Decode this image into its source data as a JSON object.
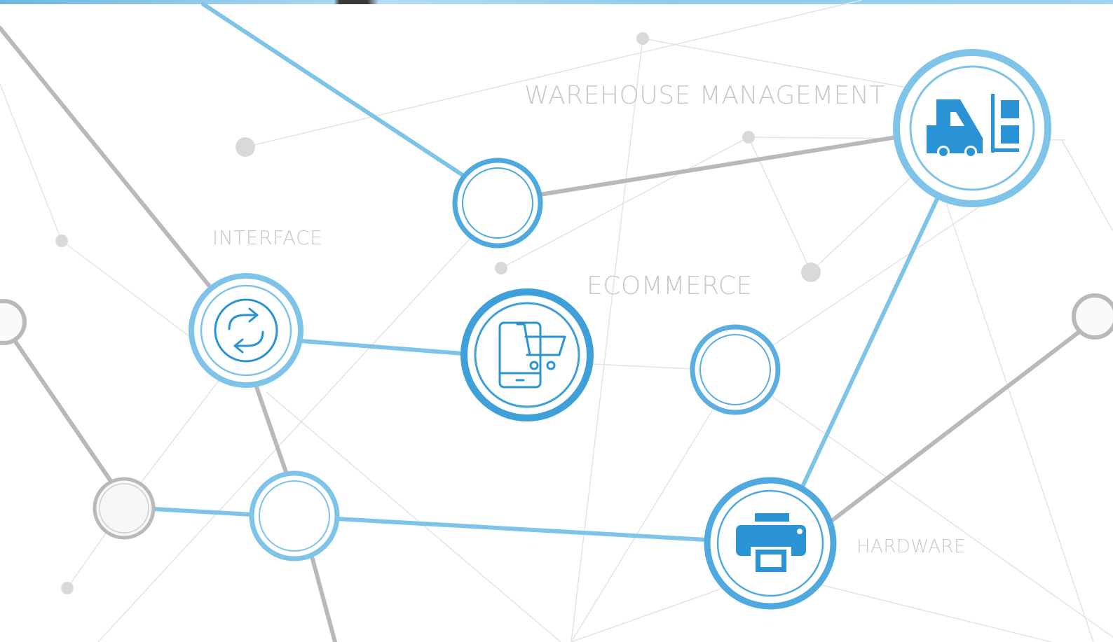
{
  "labels": {
    "warehouse": "WAREHOUSE MANAGEMENT",
    "interface": "INTERFACE",
    "ecommerce": "ECOMMERCE",
    "hardware": "HARDWARE"
  },
  "icons": {
    "warehouse": "forklift-icon",
    "interface": "sync-arrows-icon",
    "ecommerce": "mobile-shopping-cart-icon",
    "hardware": "printer-icon"
  },
  "colors": {
    "accent_blue": "#2a93d5",
    "light_blue": "#7ec3e8",
    "ring_blue": "#5aaee0",
    "gray_line": "#b9b9bd",
    "faint_line": "#e6e6e8",
    "label_gray": "#c8c8c8"
  }
}
